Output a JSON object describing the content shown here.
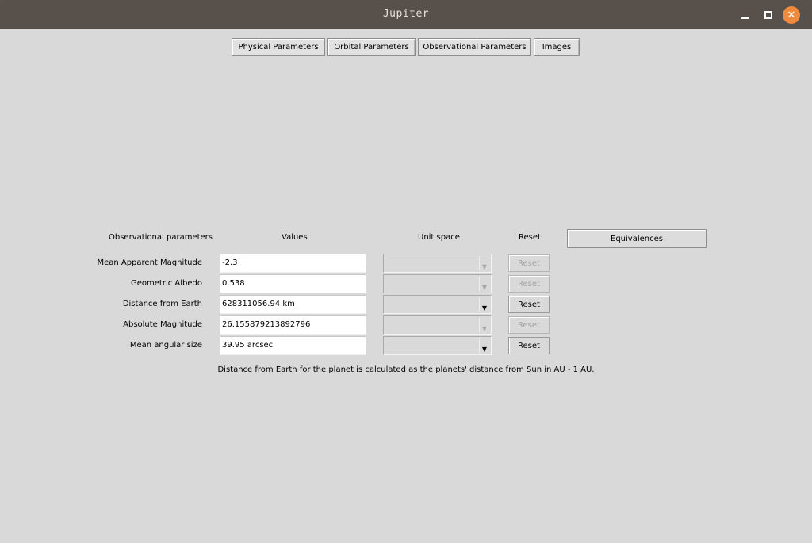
{
  "window": {
    "title": "Jupiter"
  },
  "tabs": [
    "Physical Parameters",
    "Orbital Parameters",
    "Observational Parameters",
    "Images"
  ],
  "table": {
    "headers": {
      "param": "Observational parameters",
      "values": "Values",
      "unit": "Unit space",
      "reset": "Reset"
    },
    "equivalences_label": "Equivalences",
    "rows": [
      {
        "label": "Mean Apparent Magnitude",
        "value": "-2.3",
        "unit": "",
        "reset": "Reset",
        "enabled": false
      },
      {
        "label": "Geometric Albedo",
        "value": "0.538",
        "unit": "",
        "reset": "Reset",
        "enabled": false
      },
      {
        "label": "Distance from Earth",
        "value": "628311056.94 km",
        "unit": "",
        "reset": "Reset",
        "enabled": true
      },
      {
        "label": "Absolute Magnitude",
        "value": "26.155879213892796",
        "unit": "",
        "reset": "Reset",
        "enabled": false
      },
      {
        "label": "Mean angular size",
        "value": "39.95 arcsec",
        "unit": "",
        "reset": "Reset",
        "enabled": true
      }
    ]
  },
  "note": "Distance from Earth for the planet is calculated as the planets' distance from Sun in AU - 1 AU.",
  "colors": {
    "titlebar": "#58514b",
    "close_button": "#f08a3c",
    "background": "#d9d9d9"
  },
  "icons": {
    "minimize": "minimize-icon",
    "maximize": "maximize-icon",
    "close": "close-icon",
    "dropdown": "chevron-down-icon"
  }
}
